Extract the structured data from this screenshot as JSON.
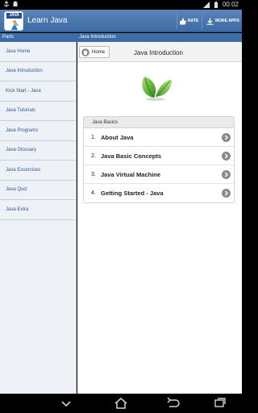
{
  "status_bar": {
    "time": "00:02"
  },
  "action_bar": {
    "app_icon_badge": "JAVA",
    "app_title": "Learn Java",
    "rate_label": "RATE",
    "more_apps_label": "MORE APPS"
  },
  "header_strip": {
    "left": "Parts",
    "right": "Java Introduction"
  },
  "sidebar": {
    "items": [
      {
        "label": "Java Home"
      },
      {
        "label": "Java Introduction"
      },
      {
        "label": "Kick Start - Java"
      },
      {
        "label": "Java Tutorials"
      },
      {
        "label": "Java Programs"
      },
      {
        "label": "Java Glossary"
      },
      {
        "label": "Java Excercises"
      },
      {
        "label": "Java Quiz"
      },
      {
        "label": "Java Extra"
      }
    ]
  },
  "main": {
    "home_label": "Home",
    "title": "Java Introduction",
    "list_header": "Java Basics",
    "items": [
      {
        "num": "1.",
        "label": "About Java"
      },
      {
        "num": "2.",
        "label": "Java Basic Concepts"
      },
      {
        "num": "3.",
        "label": "Java Virtual Machine"
      },
      {
        "num": "4.",
        "label": "Getting Started - Java"
      }
    ]
  },
  "colors": {
    "accent": "#3e6da6",
    "action_bar": "#4a78b0",
    "link": "#2a5a9a"
  },
  "icons": [
    "usb-icon",
    "android-icon",
    "signal-icon",
    "battery-icon",
    "thumbs-up-icon",
    "download-icon",
    "home-icon",
    "leaf-icon",
    "chevron-right-icon",
    "back-icon",
    "recent-apps-icon"
  ]
}
